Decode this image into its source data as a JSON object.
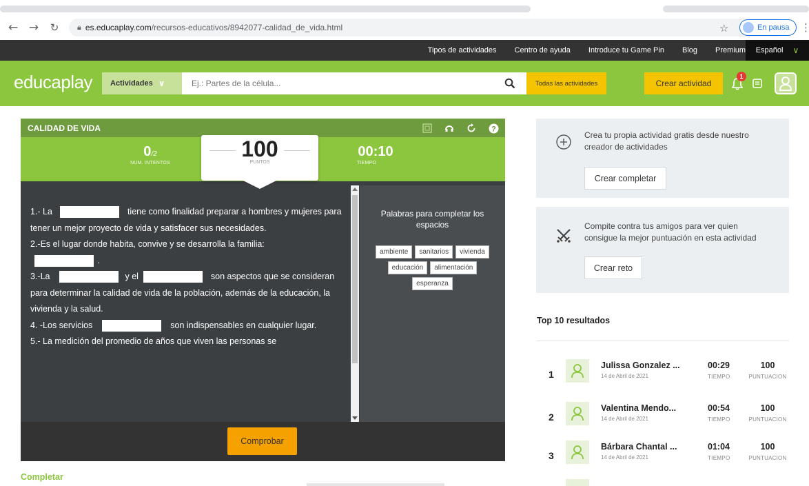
{
  "browser": {
    "url_host": "es.educaplay.com",
    "url_path": "/recursos-educativos/8942077-calidad_de_vida.html",
    "profile_label": "En pausa"
  },
  "topnav": {
    "links": [
      "Tipos de actividades",
      "Centro de ayuda",
      "Introduce tu Game Pin",
      "Blog",
      "Premium"
    ],
    "language": "Español"
  },
  "header": {
    "logo_left": "educa",
    "logo_right": "play",
    "activities_label": "Actividades",
    "search_placeholder": "Ej.: Partes de la célula...",
    "all_activities_label": "Todas las actividades",
    "create_activity_label": "Crear actividad",
    "notifications_count": "1"
  },
  "activity": {
    "title": "CALIDAD DE VIDA",
    "attempts_value": "0",
    "attempts_max": "/2",
    "attempts_label": "NUM. INTENTOS",
    "points_value": "100",
    "points_label": "PUNTOS",
    "time_value": "00:10",
    "time_label": "TIEMPO",
    "q1_a": "1.- La",
    "q1_b": "tiene como finalidad preparar a hombres y mujeres para tener un mejor proyecto de vida y satisfacer sus necesidades.",
    "q2_a": "2.-Es el lugar donde habita, convive y se desarrolla la familia:",
    "q2_b": ".",
    "q3_a": "3.-La",
    "q3_b": "y el",
    "q3_c": "son aspectos que se consideran para determinar la calidad de vida de la población, además de la educación, la vivienda y la salud.",
    "q4_a": "4. -Los servicios",
    "q4_b": "son indispensables en cualquier lugar.",
    "q5_a": "5.- La medición del promedio de años que viven las personas se",
    "words_title": "Palabras para completar los espacios",
    "words": [
      "ambiente",
      "sanitarios",
      "vivienda",
      "educación",
      "alimentación",
      "esperanza"
    ],
    "check_label": "Comprobar",
    "type_label": "Completar"
  },
  "sidebar": {
    "create_text": "Crea tu propia actividad gratis desde nuestro creador de actividades",
    "create_button": "Crear completar",
    "challenge_text": "Compite contra tus amigos para ver quien consigue la mejor puntuación en esta actividad",
    "challenge_button": "Crear reto",
    "top_title": "Top 10 resultados",
    "time_label": "TIEMPO",
    "score_label": "PUNTUACION",
    "results": [
      {
        "rank": "1",
        "name": "Julissa Gonzalez ...",
        "date": "14 de Abril de 2021",
        "time": "00:29",
        "score": "100"
      },
      {
        "rank": "2",
        "name": "Valentina Mendo...",
        "date": "14 de Abril de 2021",
        "time": "00:54",
        "score": "100"
      },
      {
        "rank": "3",
        "name": "Bárbara Chantal ...",
        "date": "14 de Abril de 2021",
        "time": "01:04",
        "score": "100"
      }
    ]
  },
  "colors": {
    "brand_green": "#8cc63f",
    "dark_green": "#6f9b3f",
    "accent_yellow": "#f5c400",
    "check_orange": "#f5a100"
  }
}
